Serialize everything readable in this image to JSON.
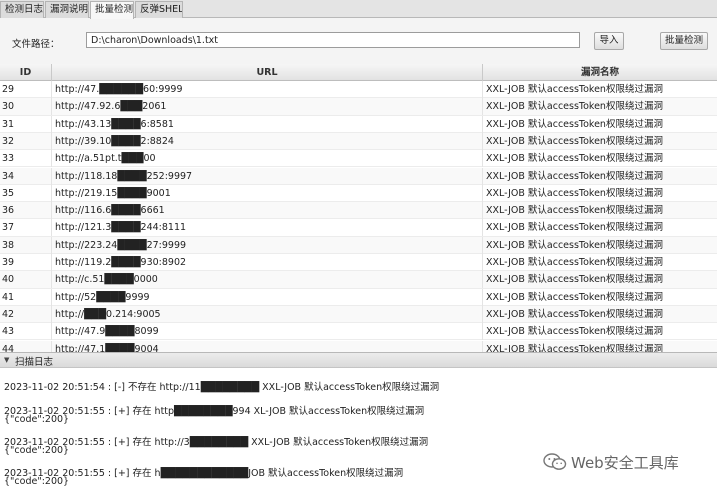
{
  "tabs": [
    {
      "label": "检测日志"
    },
    {
      "label": "漏洞说明"
    },
    {
      "label": "批量检测"
    },
    {
      "label": "反弹SHELL"
    }
  ],
  "filebar": {
    "label": "文件路径：",
    "path": "D:\\charon\\Downloads\\1.txt",
    "import_label": "导入",
    "batch_label": "批量检测"
  },
  "table": {
    "headers": [
      "ID",
      "URL",
      "漏洞名称"
    ],
    "rows": [
      {
        "id": "29",
        "url": "http://47.██████60:9999",
        "name": "XXL-JOB 默认accessToken权限绕过漏洞"
      },
      {
        "id": "30",
        "url": "http://47.92.6███2061",
        "name": "XXL-JOB 默认accessToken权限绕过漏洞"
      },
      {
        "id": "31",
        "url": "http://43.13████6:8581",
        "name": "XXL-JOB 默认accessToken权限绕过漏洞"
      },
      {
        "id": "32",
        "url": "http://39.10████2:8824",
        "name": "XXL-JOB 默认accessToken权限绕过漏洞"
      },
      {
        "id": "33",
        "url": "http://a.51pt.t███00",
        "name": "XXL-JOB 默认accessToken权限绕过漏洞"
      },
      {
        "id": "34",
        "url": "http://118.18████252:9997",
        "name": "XXL-JOB 默认accessToken权限绕过漏洞"
      },
      {
        "id": "35",
        "url": "http://219.15████9001",
        "name": "XXL-JOB 默认accessToken权限绕过漏洞"
      },
      {
        "id": "36",
        "url": "http://116.6████6661",
        "name": "XXL-JOB 默认accessToken权限绕过漏洞"
      },
      {
        "id": "37",
        "url": "http://121.3████244:8111",
        "name": "XXL-JOB 默认accessToken权限绕过漏洞"
      },
      {
        "id": "38",
        "url": "http://223.24████27:9999",
        "name": "XXL-JOB 默认accessToken权限绕过漏洞"
      },
      {
        "id": "39",
        "url": "http://119.2████930:8902",
        "name": "XXL-JOB 默认accessToken权限绕过漏洞"
      },
      {
        "id": "40",
        "url": "http://c.51████0000",
        "name": "XXL-JOB 默认accessToken权限绕过漏洞"
      },
      {
        "id": "41",
        "url": "http://52████9999",
        "name": "XXL-JOB 默认accessToken权限绕过漏洞"
      },
      {
        "id": "42",
        "url": "http://███0.214:9005",
        "name": "XXL-JOB 默认accessToken权限绕过漏洞"
      },
      {
        "id": "43",
        "url": "http://47.9████8099",
        "name": "XXL-JOB 默认accessToken权限绕过漏洞"
      },
      {
        "id": "44",
        "url": "http://47.1████9004",
        "name": "XXL-JOB 默认accessToken权限绕过漏洞"
      }
    ]
  },
  "log": {
    "title": "扫描日志",
    "lines": [
      "2023-11-02 20:51:54 : [-] 不存在    http://11████████  XXL-JOB 默认accessToken权限绕过漏洞",
      "2023-11-02 20:51:55 : [+] 存在    http████████994   XL-JOB 默认accessToken权限绕过漏洞",
      "{\"code\":200}",
      "2023-11-02 20:51:55 : [+] 存在    http://3████████   XXL-JOB 默认accessToken权限绕过漏洞",
      "{\"code\":200}",
      "2023-11-02 20:51:55 : [+] 存在    h████████████JOB 默认accessToken权限绕过漏洞",
      "{\"code\":200}"
    ]
  },
  "watermark": {
    "text": "Web安全工具库",
    "icon": "wechat-icon"
  }
}
